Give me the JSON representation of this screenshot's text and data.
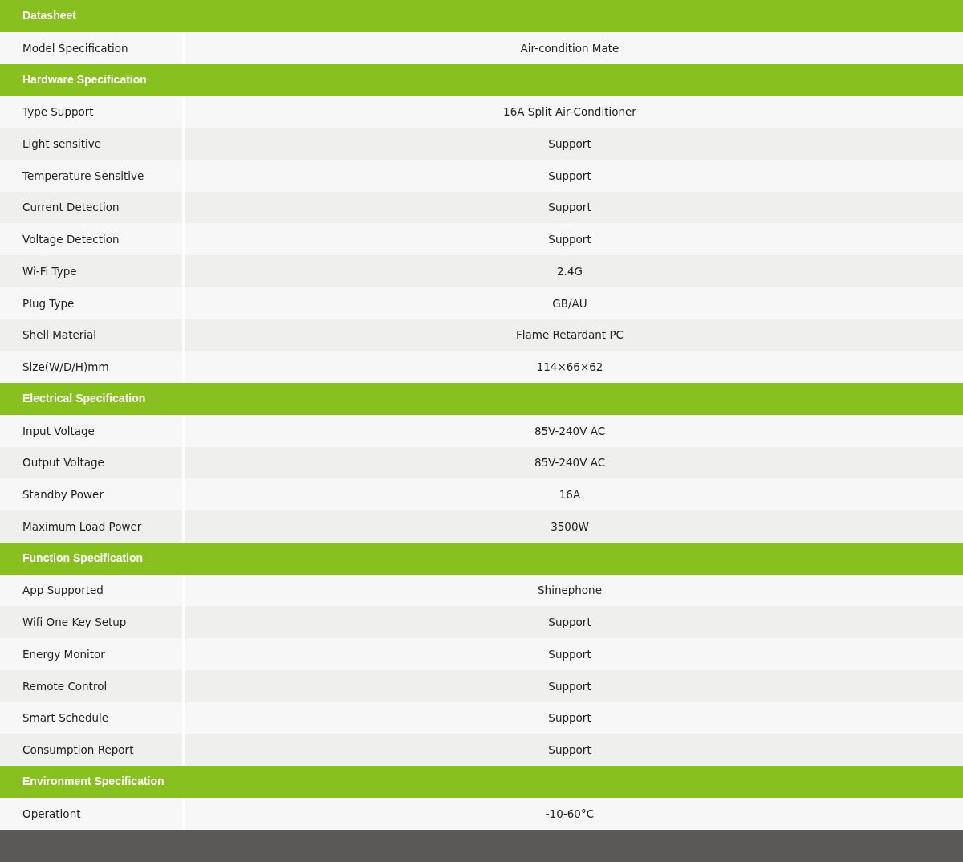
{
  "sections": [
    {
      "title": "Datasheet",
      "rows": [
        {
          "label": "Model Specification",
          "value": "Air-condition Mate"
        }
      ]
    },
    {
      "title": "Hardware Specification",
      "rows": [
        {
          "label": "Type Support",
          "value": "16A Split Air-Conditioner"
        },
        {
          "label": "Light sensitive",
          "value": "Support"
        },
        {
          "label": "Temperature Sensitive",
          "value": "Support"
        },
        {
          "label": "Current Detection",
          "value": "Support"
        },
        {
          "label": "Voltage Detection",
          "value": "Support"
        },
        {
          "label": "Wi-Fi Type",
          "value": "2.4G"
        },
        {
          "label": "Plug Type",
          "value": "GB/AU"
        },
        {
          "label": "Shell Material",
          "value": "Flame Retardant PC"
        },
        {
          "label": "Size(W/D/H)mm",
          "value": "114×66×62"
        }
      ]
    },
    {
      "title": "Electrical Specification",
      "rows": [
        {
          "label": "Input Voltage",
          "value": "85V-240V AC"
        },
        {
          "label": "Output Voltage",
          "value": "85V-240V AC"
        },
        {
          "label": "Standby Power",
          "value": "16A"
        },
        {
          "label": "Maximum Load Power",
          "value": "3500W"
        }
      ]
    },
    {
      "title": "Function Specification",
      "rows": [
        {
          "label": "App Supported",
          "value": "Shinephone"
        },
        {
          "label": "Wifi One Key Setup",
          "value": "Support"
        },
        {
          "label": "Energy Monitor",
          "value": "Support"
        },
        {
          "label": "Remote Control",
          "value": "Support"
        },
        {
          "label": "Smart Schedule",
          "value": "Support"
        },
        {
          "label": "Consumption Report",
          "value": "Support"
        }
      ]
    },
    {
      "title": "Environment Specification",
      "rows": [
        {
          "label": "Operationt",
          "value": "-10-60°C"
        }
      ]
    }
  ]
}
